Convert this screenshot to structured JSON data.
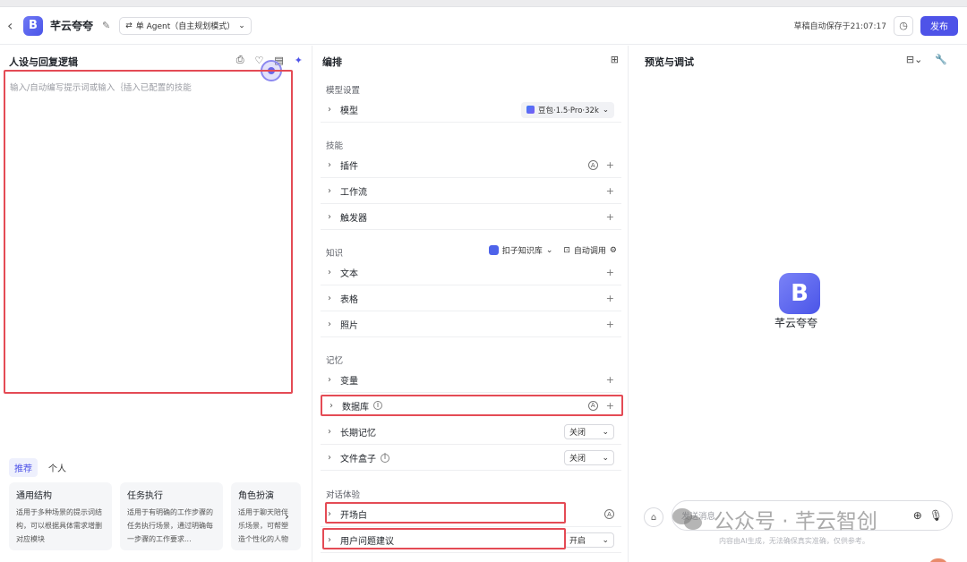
{
  "header": {
    "back_icon": "chevron-left-icon",
    "app_logo_letter": "B",
    "app_name": "芊云夸夸",
    "agent_mode": "单 Agent（自主规划模式）",
    "save_status": "草稿自动保存于21:07:17",
    "publish_label": "发布"
  },
  "left": {
    "title": "人设与回复逻辑",
    "prompt_placeholder": "输入/自动编写提示词或输入｛插入已配置的技能",
    "tabs": [
      "推荐",
      "个人"
    ],
    "cards": [
      {
        "title": "通用结构",
        "desc": "适用于多种场景的提示词结构，可以根据具体需求增删对应模块"
      },
      {
        "title": "任务执行",
        "desc": "适用于有明确的工作步骤的任务执行场景，通过明确每一步骤的工作要求..."
      },
      {
        "title": "角色扮演",
        "desc": "适用于聊天陪伴乐场景，可帮塑造个性化的人物"
      }
    ]
  },
  "mid": {
    "title": "编排",
    "model_section": "模型设置",
    "model_label": "模型",
    "model_value": "豆包·1.5·Pro·32k",
    "skills_section": "技能",
    "skills": [
      "插件",
      "工作流",
      "触发器"
    ],
    "knowledge_section": "知识",
    "kb_select": "扣子知识库",
    "auto_call": "自动调用",
    "knowledge": [
      "文本",
      "表格",
      "照片"
    ],
    "memory_section": "记忆",
    "memory_variable": "变量",
    "memory_database": "数据库",
    "memory_longterm": "长期记忆",
    "memory_longterm_value": "关闭",
    "memory_filebox": "文件盒子",
    "memory_filebox_value": "关闭",
    "dialog_section": "对话体验",
    "dialog_opening": "开场白",
    "dialog_suggest": "用户问题建议",
    "dialog_suggest_value": "开启"
  },
  "right": {
    "title": "预览与调试",
    "bot_logo_letter": "B",
    "bot_name": "芊云夸夸",
    "input_placeholder": "发送消息",
    "disclaimer": "内容由AI生成，无法确保真实准确，仅供参考。",
    "watermark": "公众号 · 芊云智创"
  },
  "colors": {
    "accent": "#4e53e8",
    "highlight": "#e44b55"
  }
}
